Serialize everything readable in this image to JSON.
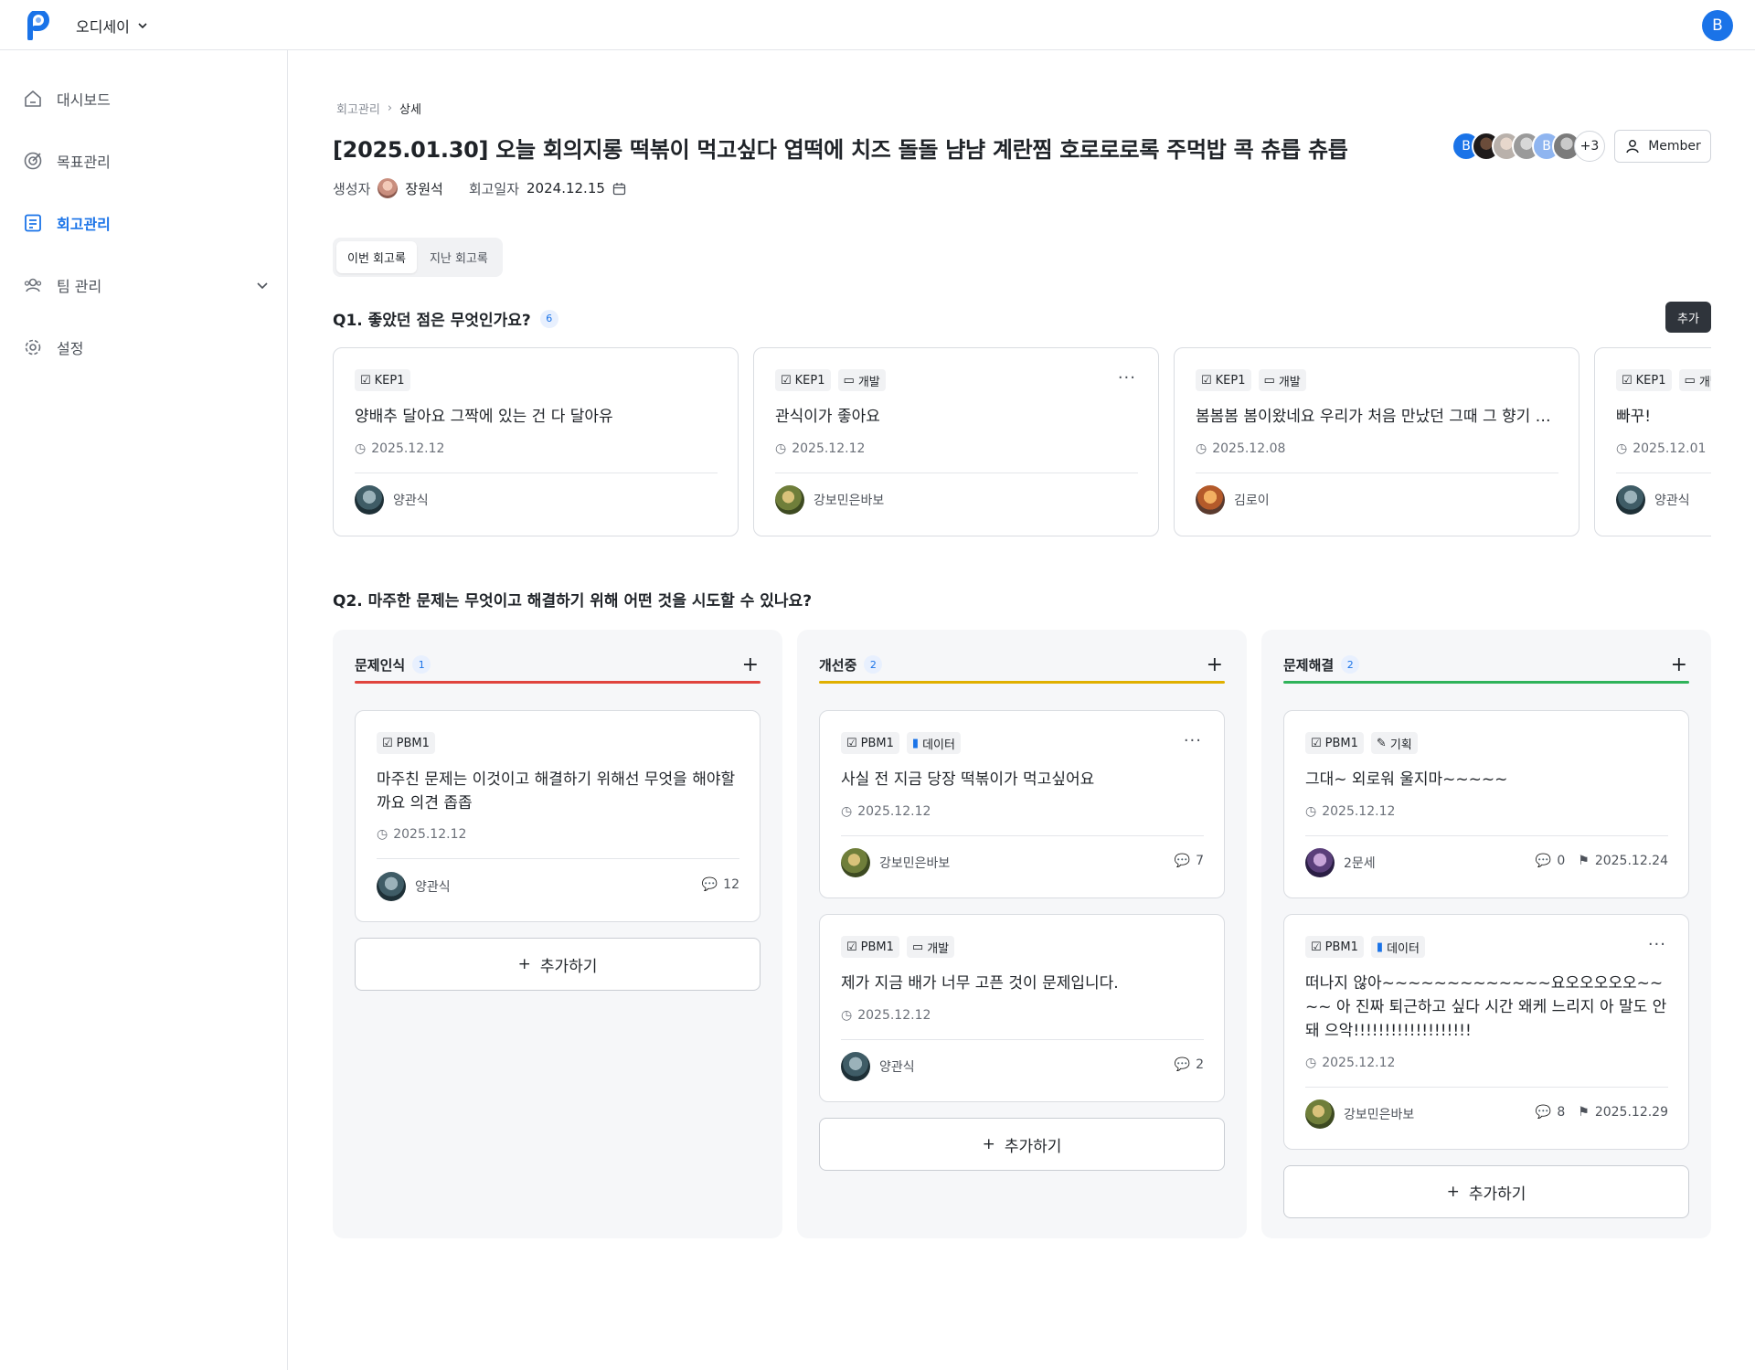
{
  "app": {
    "workspace": "오디세이",
    "user_initial": "B"
  },
  "sidebar": {
    "items": [
      {
        "label": "대시보드"
      },
      {
        "label": "목표관리"
      },
      {
        "label": "회고관리"
      },
      {
        "label": "팀 관리"
      },
      {
        "label": "설정"
      }
    ]
  },
  "breadcrumb": {
    "parent": "회고관리",
    "current": "상세"
  },
  "page": {
    "title": "[2025.01.30] 오늘 회의지롱 떡볶이 먹고싶다 엽떡에 치즈 돌돌 냠냠 계란찜 호로로로록 주먹밥 콕 츄릅 츄릅",
    "creator_label": "생성자",
    "creator_name": "장원석",
    "date_label": "회고일자",
    "date_value": "2024.12.15",
    "member_more": "+3",
    "member_initial": "B",
    "member_button": "Member"
  },
  "tabs": [
    {
      "label": "이번 회고록",
      "active": true
    },
    {
      "label": "지난 회고록",
      "active": false
    }
  ],
  "q1": {
    "title": "Q1. 좋았던 점은 무엇인가요?",
    "count": "6",
    "add_label": "추가",
    "cards": [
      {
        "chips": [
          "KEP1"
        ],
        "text": "양배추 달아요 그짝에 있는 건 다 달아유",
        "date": "2025.12.12",
        "author": "양관식"
      },
      {
        "chips": [
          "KEP1",
          "개발"
        ],
        "text": "관식이가 좋아요",
        "date": "2025.12.12",
        "author": "강보민은바보"
      },
      {
        "chips": [
          "KEP1",
          "개발"
        ],
        "text": "봄봄봄 봄이왔네요 우리가 처음 만났던 그때 그 향기 그대로 그대가 앉아 있었던 그 벤치 옆에 나무도",
        "date": "2025.12.08",
        "author": "김로이"
      },
      {
        "chips": [
          "KEP1",
          "개발"
        ],
        "text": "빠꾸!",
        "date": "2025.12.01",
        "author": "양관식"
      }
    ]
  },
  "q2": {
    "title": "Q2. 마주한 문제는 무엇이고 해결하기 위해 어떤 것을 시도할 수 있나요?",
    "add_more_label": "추가하기",
    "columns": [
      {
        "title": "문제인식",
        "count": "1",
        "color": "#e0443e",
        "cards": [
          {
            "chips": [
              "PBM1"
            ],
            "text": "마주친 문제는 이것이고 해결하기 위해선 무엇을 해야할까요 의견 좁좁",
            "date": "2025.12.12",
            "author": "양관식",
            "comments": "12"
          }
        ]
      },
      {
        "title": "개선중",
        "count": "2",
        "color": "#e0b000",
        "cards": [
          {
            "chips": [
              "PBM1",
              "데이터"
            ],
            "text": "사실 전 지금 당장 떡볶이가 먹고싶어요",
            "date": "2025.12.12",
            "author": "강보민은바보",
            "comments": "7"
          },
          {
            "chips": [
              "PBM1",
              "개발"
            ],
            "text": "제가 지금 배가 너무 고픈 것이 문제입니다.",
            "date": "2025.12.12",
            "author": "양관식",
            "comments": "2"
          }
        ]
      },
      {
        "title": "문제해결",
        "count": "2",
        "color": "#2fb35a",
        "cards": [
          {
            "chips": [
              "PBM1",
              "기획"
            ],
            "text": "그대~ 외로워 울지마~~~~~",
            "date": "2025.12.12",
            "author": "2문세",
            "comments": "0",
            "resolved": "2025.12.24"
          },
          {
            "chips": [
              "PBM1",
              "데이터"
            ],
            "text": "떠나지 않아~~~~~~~~~~~~~요오오오오오~~~~ 아 진짜 퇴근하고 싶다 시간 왜케 느리지 아 말도 안돼 으악!!!!!!!!!!!!!!!!!!!",
            "date": "2025.12.12",
            "author": "강보민은바보",
            "comments": "8",
            "resolved": "2025.12.29"
          }
        ]
      }
    ]
  },
  "colors": {
    "accent": "#1a73e8",
    "dark_button": "#2f343b"
  }
}
